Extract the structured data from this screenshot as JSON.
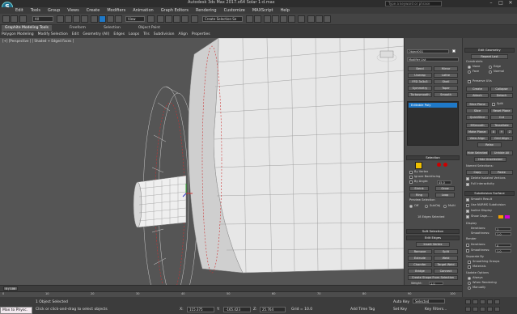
{
  "title": "Autodesk 3ds Max 2017.x64   Solar 1-d.max",
  "search_placeholder": "Type a keyword or phrase",
  "menu": [
    "Edit",
    "Tools",
    "Group",
    "Views",
    "Create",
    "Modifiers",
    "Animation",
    "Graph Editors",
    "Rendering",
    "Customize",
    "MAXScript",
    "Help"
  ],
  "toolbar": {
    "undo_select": "All",
    "view_select": "View",
    "selection_set": "Create Selection Se"
  },
  "ribbon": {
    "tabs": [
      "Graphite Modeling Tools",
      "Freeform",
      "Selection",
      "Object Paint"
    ],
    "items": [
      "Polygon Modeling",
      "Modify Selection",
      "Edit",
      "Geometry (All)",
      "Edges",
      "Loops",
      "Tris",
      "Subdivision",
      "Align",
      "Properties"
    ]
  },
  "viewport": {
    "label": "[+] [Perspective ] [ Shaded + Edged Faces ]"
  },
  "modifier": {
    "object_name": "Object001",
    "modifier_list": "Modifier List",
    "buttons": [
      "Bend",
      "Mirror",
      "Symmetry",
      "Taper",
      "FFD 3x3x3",
      "Shell",
      "Turbosmooth",
      "Smooth",
      "Uvwrap",
      "Lathe"
    ],
    "stack_item": "Editable Poly"
  },
  "selection": {
    "header": "Selection",
    "by_vertex": "By Vertex",
    "ignore_backfacing": "Ignore Backfacing",
    "by_angle": "By Angle:",
    "angle": "45.0",
    "shrink": "Shrink",
    "grow": "Grow",
    "ring": "Ring",
    "loop": "Loop",
    "preview": "Preview Selection",
    "off": "Off",
    "subobj": "SubObj",
    "multi": "Multi",
    "status": "18 Edges Selected"
  },
  "soft_selection": "Soft Selection",
  "edit_edges": {
    "header": "Edit Edges",
    "insert_vertex": "Insert Vertex",
    "remove": "Remove",
    "split": "Split",
    "extrude": "Extrude",
    "weld": "Weld",
    "chamfer": "Chamfer",
    "target_weld": "Target Weld",
    "bridge": "Bridge",
    "connect": "Connect",
    "create_shape": "Create Shape From Selection",
    "weight": "Weight:",
    "weight_val": "1.0",
    "crease": "Crease:",
    "crease_val": "0.0"
  },
  "edit_geometry": {
    "header": "Edit Geometry",
    "repeat_last": "Repeat Last",
    "constraints": "Constraints",
    "none": "None",
    "edge": "Edge",
    "face": "Face",
    "normal": "Normal",
    "preserve_uvs": "Preserve UVs",
    "create": "Create",
    "collapse": "Collapse",
    "attach": "Attach",
    "detach": "Detach",
    "slice_plane": "Slice Plane",
    "split": "Split",
    "slice": "Slice",
    "reset_plane": "Reset Plane",
    "quickslice": "QuickSlice",
    "cut": "Cut",
    "msmooth": "MSmooth",
    "tessellate": "Tessellate",
    "make_planar": "Make Planar",
    "x": "X",
    "y": "Y",
    "z": "Z",
    "view_align": "View Align",
    "grid_align": "Grid Align",
    "relax": "Relax",
    "hide_selected": "Hide Selected",
    "unhide_all": "Unhide All",
    "hide_unselected": "Hide Unselected"
  },
  "named_selections": {
    "header": "Named Selections:",
    "copy": "Copy",
    "paste": "Paste",
    "delete_isolated": "Delete Isolated Vertices",
    "full_interactivity": "Full Interactivity"
  },
  "subdivision": {
    "header": "Subdivision Surface",
    "smooth_result": "Smooth Result",
    "use_nurms": "Use NURMS Subdivision",
    "isoline": "Isoline Display",
    "show_cage": "Show Cage......",
    "display": "Display",
    "iterations": "Iterations:",
    "iterations_val": "1",
    "smoothness": "Smoothness:",
    "smoothness_val": "1.0",
    "render": "Render",
    "r_iterations": "Iterations:",
    "r_iterations_val": "0",
    "r_smoothness": "Smoothness:",
    "r_smoothness_val": "1.0",
    "separate_by": "Separate By",
    "smoothing_groups": "Smoothing Groups",
    "materials": "Materials",
    "update_options": "Update Options",
    "always": "Always",
    "when_rendering": "When Rendering",
    "manually": "Manually"
  },
  "timeline": {
    "frame": "0 / 100",
    "ticks": [
      "0",
      "10",
      "20",
      "30",
      "40",
      "50",
      "60",
      "70",
      "80",
      "90",
      "100"
    ]
  },
  "status": {
    "maxscript": "Max to Physc.",
    "line1": "1 Object Selected",
    "line2": "Click or click-and-drag to select objects",
    "x": "115.375",
    "y": "-165.423",
    "z": "25.764",
    "grid": "Grid = 10.0",
    "autokey": "Auto Key",
    "setkey": "Set Key",
    "selected": "Selected",
    "keyfilters": "Key Filters...",
    "add_time_tag": "Add Time Tag"
  },
  "colors": {
    "accent": "#1f79c8",
    "viewport_bg": "#555555",
    "panel_bg": "#4b4b4b"
  }
}
